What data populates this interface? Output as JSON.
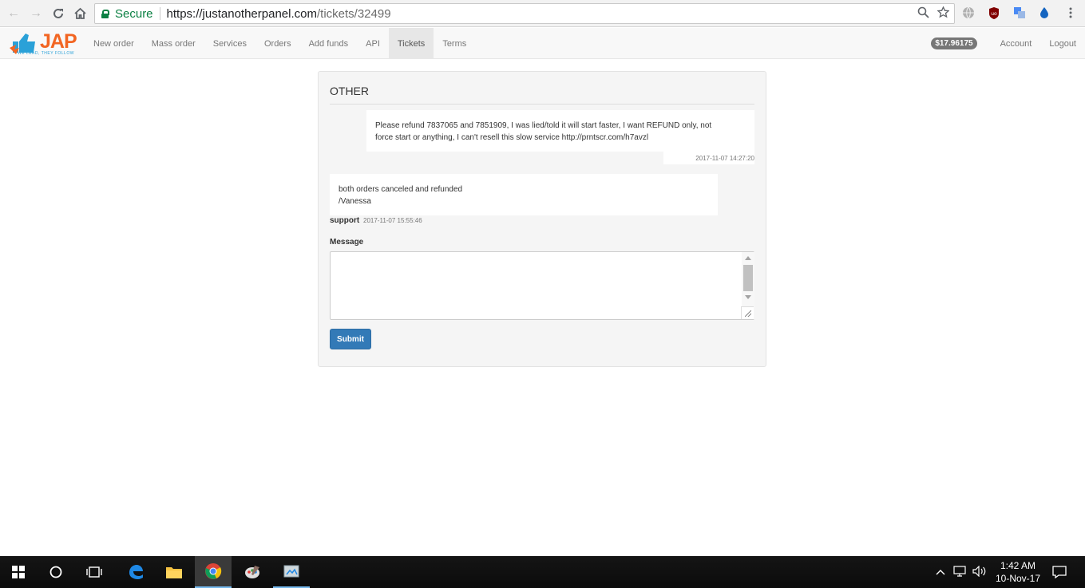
{
  "browser": {
    "secure_label": "Secure",
    "url_base": "https://justanotherpanel.com",
    "url_path": "/tickets/32499"
  },
  "site": {
    "logo_text": "JAP",
    "logo_tagline": "WE LEAD, THEY FOLLOW",
    "nav": [
      {
        "label": "New order"
      },
      {
        "label": "Mass order"
      },
      {
        "label": "Services"
      },
      {
        "label": "Orders"
      },
      {
        "label": "Add funds"
      },
      {
        "label": "API"
      },
      {
        "label": "Tickets",
        "active": true
      },
      {
        "label": "Terms"
      }
    ],
    "balance": "$17.96175",
    "account_label": "Account",
    "logout_label": "Logout"
  },
  "ticket": {
    "subject": "OTHER",
    "messages": [
      {
        "line1": "Please refund 7837065 and 7851909, I was lied/told it will start faster, I want REFUND only, not",
        "line2": "force start or anything, I can't resell this slow service http://prntscr.com/h7avzl",
        "time": "2017-11-07 14:27:20"
      },
      {
        "line1": "both orders canceled and refunded",
        "line2": "/Vanessa",
        "author": "support",
        "time": "2017-11-07 15:55:46"
      }
    ],
    "message_label": "Message",
    "message_value": "",
    "submit_label": "Submit"
  },
  "taskbar": {
    "time": "1:42 AM",
    "date": "10-Nov-17"
  },
  "colors": {
    "primary_button": "#337ab7",
    "secure_green": "#0b8043",
    "logo_orange": "#f26522",
    "logo_blue": "#2aa1d8"
  }
}
